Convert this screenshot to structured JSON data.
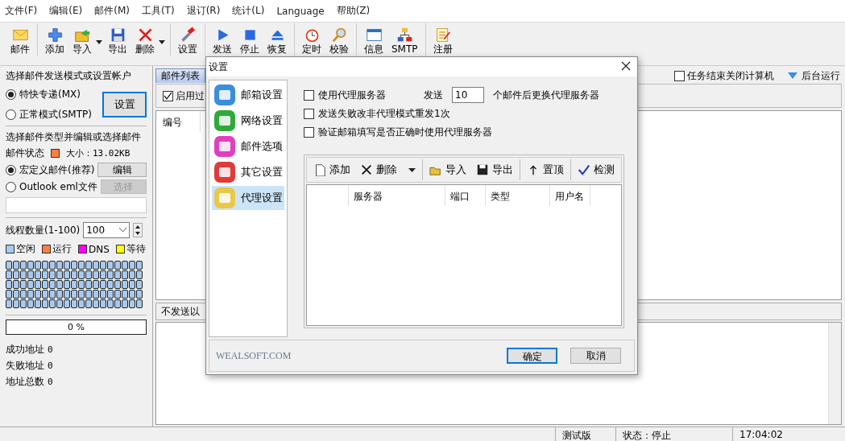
{
  "menu": [
    "文件(F)",
    "编辑(E)",
    "邮件(M)",
    "工具(T)",
    "退订(R)",
    "统计(L)",
    "Language",
    "帮助(Z)"
  ],
  "toolbar": {
    "groups": [
      [
        {
          "label": "邮件",
          "dropdown": false
        }
      ],
      [
        {
          "label": "添加",
          "dropdown": false
        },
        {
          "label": "导入",
          "dropdown": true
        },
        {
          "label": "导出",
          "dropdown": false
        },
        {
          "label": "删除",
          "dropdown": true
        }
      ],
      [
        {
          "label": "设置",
          "dropdown": false
        }
      ],
      [
        {
          "label": "发送",
          "dropdown": false
        },
        {
          "label": "停止",
          "dropdown": false
        },
        {
          "label": "恢复",
          "dropdown": false
        }
      ],
      [
        {
          "label": "定时",
          "dropdown": false
        },
        {
          "label": "校验",
          "dropdown": false
        }
      ],
      [
        {
          "label": "信息",
          "dropdown": false
        },
        {
          "label": "SMTP",
          "dropdown": false
        }
      ],
      [
        {
          "label": "注册",
          "dropdown": false
        }
      ]
    ]
  },
  "left_panel": {
    "send_mode": {
      "heading": "选择邮件发送模式或设置帐户",
      "options": [
        {
          "label": "特快专递(MX)",
          "selected": true
        },
        {
          "label": "正常模式(SMTP)",
          "selected": false
        }
      ],
      "button": "设置"
    },
    "mail_type": {
      "heading": "选择邮件类型并编辑或选择邮件",
      "status": {
        "label": "邮件状态",
        "color": "#ff7f3f"
      },
      "size": "大小：13.02KB",
      "options": [
        {
          "label": "宏定义邮件(推荐)",
          "selected": true,
          "button": "编辑",
          "disabled": false
        },
        {
          "label": "Outlook eml文件",
          "selected": false,
          "button": "选择",
          "disabled": true
        }
      ]
    },
    "threads": {
      "label": "线程数量(1-100)",
      "value": "100",
      "legend": [
        {
          "label": "空闲",
          "color": "#a6caf0"
        },
        {
          "label": "运行",
          "color": "#ff7f3f"
        },
        {
          "label": "DNS",
          "color": "#ff00ff"
        },
        {
          "label": "等待",
          "color": "#ffff00"
        }
      ],
      "slots": [
        {
          "color": "#a6caf0"
        },
        {
          "color": "#a6caf0"
        },
        {
          "color": "#a6caf0"
        },
        {
          "color": "#a6caf0"
        },
        {
          "color": "#a6caf0"
        },
        {
          "color": "#a6caf0"
        },
        {
          "color": "#a6caf0"
        },
        {
          "color": "#a6caf0"
        },
        {
          "color": "#a6caf0"
        },
        {
          "color": "#a6caf0"
        },
        {
          "color": "#a6caf0"
        },
        {
          "color": "#a6caf0"
        },
        {
          "color": "#a6caf0"
        },
        {
          "color": "#a6caf0"
        },
        {
          "color": "#a6caf0"
        },
        {
          "color": "#a6caf0"
        },
        {
          "color": "#a6caf0"
        },
        {
          "color": "#a6caf0"
        },
        {
          "color": "#a6caf0"
        },
        {
          "color": "#a6caf0"
        },
        {
          "color": "#a6caf0"
        },
        {
          "color": "#a6caf0"
        },
        {
          "color": "#a6caf0"
        },
        {
          "color": "#a6caf0"
        },
        {
          "color": "#a6caf0"
        },
        {
          "color": "#a6caf0"
        },
        {
          "color": "#a6caf0"
        },
        {
          "color": "#a6caf0"
        },
        {
          "color": "#a6caf0"
        },
        {
          "color": "#a6caf0"
        },
        {
          "color": "#a6caf0"
        },
        {
          "color": "#a6caf0"
        },
        {
          "color": "#a6caf0"
        },
        {
          "color": "#a6caf0"
        },
        {
          "color": "#a6caf0"
        },
        {
          "color": "#a6caf0"
        },
        {
          "color": "#a6caf0"
        },
        {
          "color": "#a6caf0"
        },
        {
          "color": "#a6caf0"
        },
        {
          "color": "#a6caf0"
        },
        {
          "color": "#a6caf0"
        },
        {
          "color": "#a6caf0"
        },
        {
          "color": "#a6caf0"
        },
        {
          "color": "#a6caf0"
        },
        {
          "color": "#a6caf0"
        },
        {
          "color": "#a6caf0"
        },
        {
          "color": "#a6caf0"
        },
        {
          "color": "#a6caf0"
        },
        {
          "color": "#a6caf0"
        },
        {
          "color": "#a6caf0"
        },
        {
          "color": "#a6caf0"
        },
        {
          "color": "#a6caf0"
        },
        {
          "color": "#a6caf0"
        },
        {
          "color": "#a6caf0"
        },
        {
          "color": "#a6caf0"
        },
        {
          "color": "#a6caf0"
        },
        {
          "color": "#a6caf0"
        },
        {
          "color": "#a6caf0"
        },
        {
          "color": "#a6caf0"
        },
        {
          "color": "#a6caf0"
        },
        {
          "color": "#a6caf0"
        },
        {
          "color": "#a6caf0"
        },
        {
          "color": "#a6caf0"
        },
        {
          "color": "#a6caf0"
        },
        {
          "color": "#a6caf0"
        },
        {
          "color": "#a6caf0"
        },
        {
          "color": "#a6caf0"
        },
        {
          "color": "#a6caf0"
        },
        {
          "color": "#a6caf0"
        },
        {
          "color": "#a6caf0"
        },
        {
          "color": "#a6caf0"
        },
        {
          "color": "#a6caf0"
        },
        {
          "color": "#a6caf0"
        },
        {
          "color": "#a6caf0"
        },
        {
          "color": "#a6caf0"
        },
        {
          "color": "#a6caf0"
        },
        {
          "color": "#a6caf0"
        },
        {
          "color": "#a6caf0"
        },
        {
          "color": "#a6caf0"
        },
        {
          "color": "#a6caf0"
        },
        {
          "color": "#a6caf0"
        },
        {
          "color": "#a6caf0"
        },
        {
          "color": "#a6caf0"
        },
        {
          "color": "#a6caf0"
        },
        {
          "color": "#a6caf0"
        },
        {
          "color": "#a6caf0"
        },
        {
          "color": "#a6caf0"
        },
        {
          "color": "#a6caf0"
        },
        {
          "color": "#a6caf0"
        },
        {
          "color": "#a6caf0"
        },
        {
          "color": "#a6caf0"
        },
        {
          "color": "#a6caf0"
        },
        {
          "color": "#a6caf0"
        },
        {
          "color": "#a6caf0"
        },
        {
          "color": "#a6caf0"
        }
      ]
    },
    "progress": {
      "level": 0,
      "text": "0 %"
    },
    "stats": [
      {
        "label": "成功地址",
        "value": "0"
      },
      {
        "label": "失败地址",
        "value": "0"
      },
      {
        "label": "地址总数",
        "value": "0"
      }
    ]
  },
  "main": {
    "tabs": [
      {
        "label": "邮件列表",
        "selected": true
      }
    ],
    "shutdown": {
      "label": "任务结束关闭计算机",
      "checked": false
    },
    "background": "后台运行",
    "filter": {
      "label": "启用过",
      "checked": true
    },
    "columns": [
      "编号"
    ],
    "exclude_bar": "不发送以"
  },
  "status_bar": [
    "测试版",
    "状态：停止",
    "17:04:02"
  ],
  "dialog": {
    "title": "设置",
    "nav": [
      {
        "label": "邮箱设置",
        "selected": false
      },
      {
        "label": "网络设置",
        "selected": false
      },
      {
        "label": "邮件选项",
        "selected": false
      },
      {
        "label": "其它设置",
        "selected": false
      },
      {
        "label": "代理设置",
        "selected": true
      }
    ],
    "options": [
      {
        "label": "使用代理服务器",
        "checked": false,
        "send_label": "发送",
        "send_value": "10",
        "suffix": "个邮件后更换代理服务器"
      },
      {
        "label": "发送失败改非代理模式重发1次",
        "checked": false
      },
      {
        "label": "验证邮箱填写是否正确时使用代理服务器",
        "checked": false
      }
    ],
    "toolbar": [
      [
        {
          "label": "添加",
          "dropdown": false
        },
        {
          "label": "删除",
          "dropdown": true
        }
      ],
      [
        {
          "label": "导入",
          "dropdown": false
        },
        {
          "label": "导出",
          "dropdown": false
        }
      ],
      [
        {
          "label": "置顶",
          "dropdown": false
        }
      ],
      [
        {
          "label": "检测",
          "dropdown": false
        }
      ]
    ],
    "columns": [
      "服务器",
      "端口",
      "类型",
      "用户名"
    ],
    "brand": "WEALSOFT.COM",
    "buttons": [
      {
        "label": "确定",
        "default": true
      },
      {
        "label": "取消",
        "default": false
      }
    ]
  }
}
